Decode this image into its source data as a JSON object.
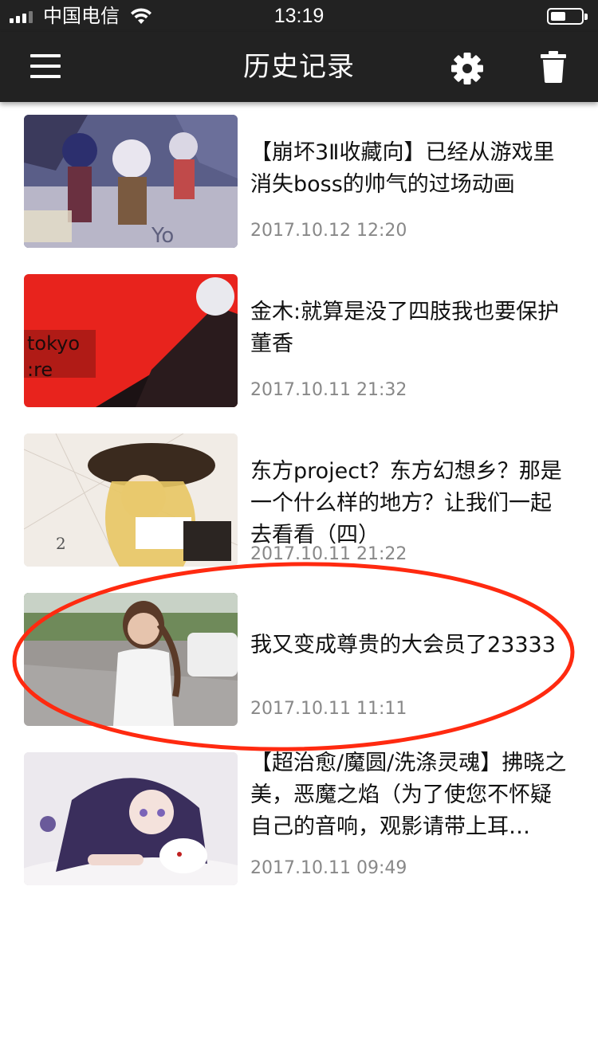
{
  "status_bar": {
    "carrier": "中国电信",
    "time": "13:19"
  },
  "header": {
    "title": "历史记录",
    "menu_icon": "hamburger-menu-icon",
    "settings_icon": "gear-icon",
    "delete_icon": "trash-icon"
  },
  "history": {
    "items": [
      {
        "title": "【崩坏3Ⅱ收藏向】已经从游戏里消失boss的帅气的过场动画",
        "time": "2017.10.12 12:20"
      },
      {
        "title": "金木:就算是没了四肢我也要保护董香",
        "time": "2017.10.11 21:32"
      },
      {
        "title": "东方project？东方幻想乡？那是一个什么样的地方？让我们一起去看看（四）",
        "time": "2017.10.11 21:22"
      },
      {
        "title": "我又变成尊贵的大会员了23333",
        "time": "2017.10.11 11:11"
      },
      {
        "title": "【超治愈/魔圆/洗涤灵魂】拂晓之美，恶魔之焰（为了使您不怀疑自己的音响，观影请带上耳…",
        "time": "2017.10.11 09:49"
      }
    ]
  },
  "colors": {
    "bar_background": "#222222",
    "annotation": "#ff2a10",
    "time_text": "#888888"
  }
}
